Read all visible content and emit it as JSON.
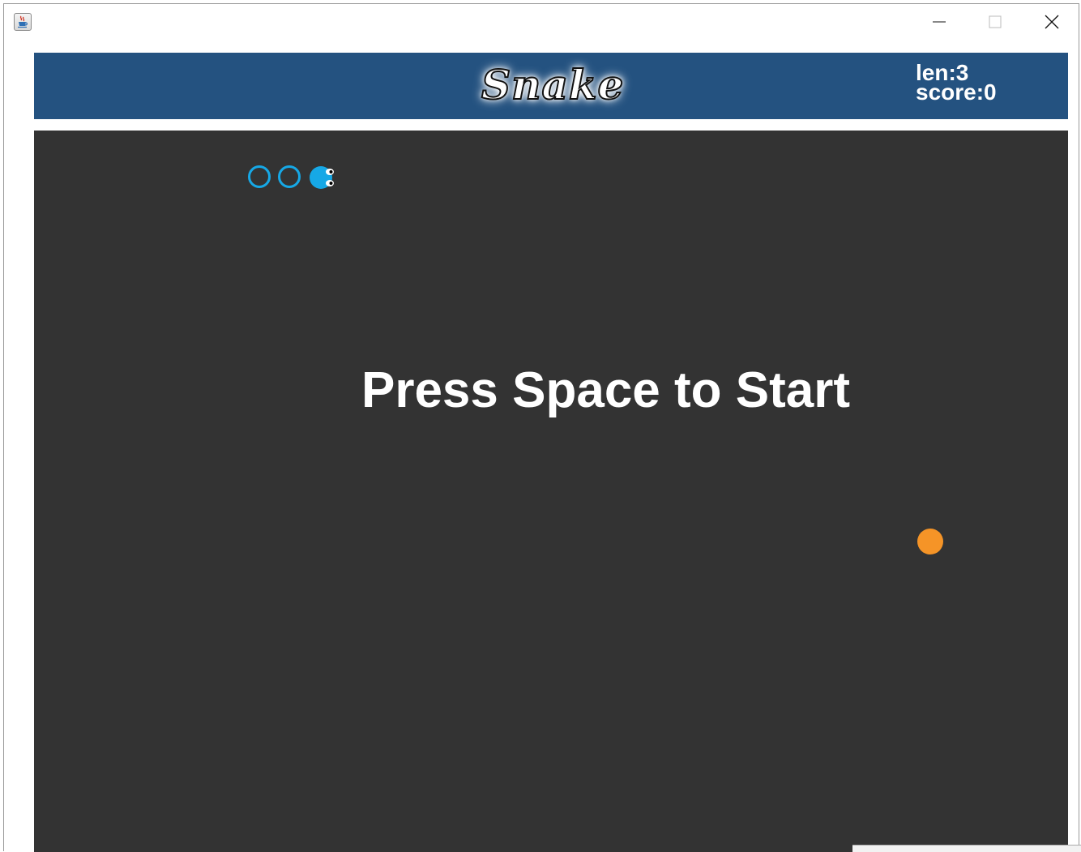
{
  "window": {
    "icon": "java-cup-icon",
    "buttons": [
      "minimize-icon",
      "maximize-icon",
      "close-icon"
    ]
  },
  "header": {
    "logo_text": "Snake",
    "len_label": "len:3",
    "score_label": "score:0",
    "background_color": "#245280"
  },
  "game": {
    "background_color": "#333333",
    "message": "Press Space to Start",
    "snake": {
      "length": 3,
      "direction": "right",
      "color": "#16a8e6"
    },
    "food": {
      "color": "#f59427"
    }
  }
}
